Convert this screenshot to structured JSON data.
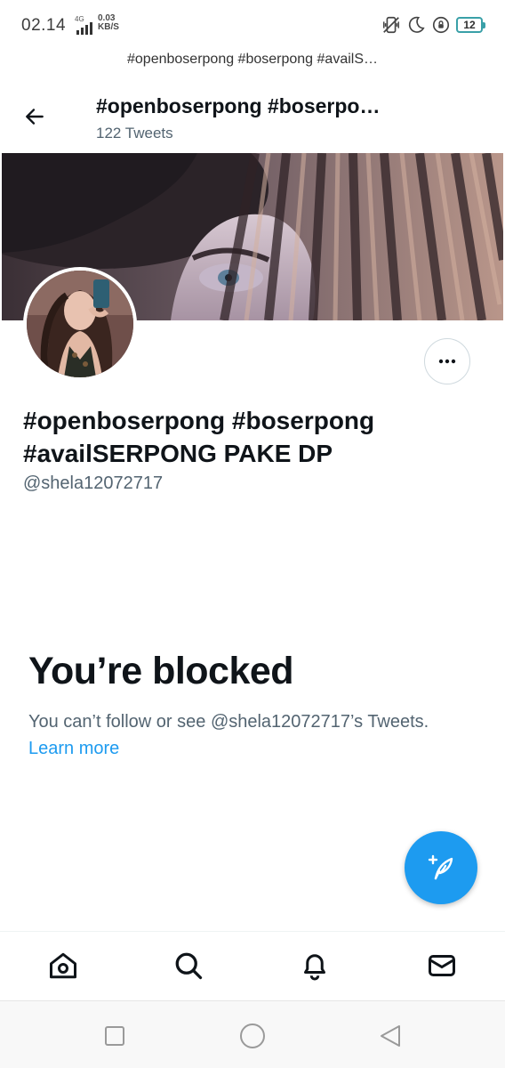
{
  "status_bar": {
    "time": "02.14",
    "network_type": "4G",
    "speed_value": "0.03",
    "speed_unit": "KB/S",
    "battery_level": "12",
    "icons": [
      "vibrate-icon",
      "moon-icon",
      "rotation-lock-icon",
      "battery-icon"
    ]
  },
  "top_strip": {
    "text": "#openboserpong #boserpong #availS…"
  },
  "header": {
    "title": "#openboserpong #boserpo…",
    "tweet_count": "122 Tweets",
    "back_icon": "arrow-left-icon"
  },
  "profile": {
    "display_name": "#openboserpong #boserpong #availSERPONG PAKE DP",
    "handle": "@shela12072717",
    "more_icon": "more-horizontal-icon"
  },
  "blocked": {
    "title": "You’re blocked",
    "message": "You can’t follow or see @shela12072717’s Tweets.",
    "link_label": "Learn more"
  },
  "fab": {
    "icon": "compose-tweet-icon"
  },
  "bottom_nav": {
    "items": [
      {
        "icon": "home-icon"
      },
      {
        "icon": "search-icon"
      },
      {
        "icon": "notifications-bell-icon"
      },
      {
        "icon": "messages-envelope-icon"
      }
    ]
  },
  "system_nav": {
    "items": [
      {
        "icon": "recent-apps-square-icon"
      },
      {
        "icon": "home-circle-icon"
      },
      {
        "icon": "back-triangle-icon"
      }
    ]
  },
  "colors": {
    "accent": "#1d9bf0",
    "text_primary": "#0f1419",
    "text_secondary": "#536471"
  }
}
